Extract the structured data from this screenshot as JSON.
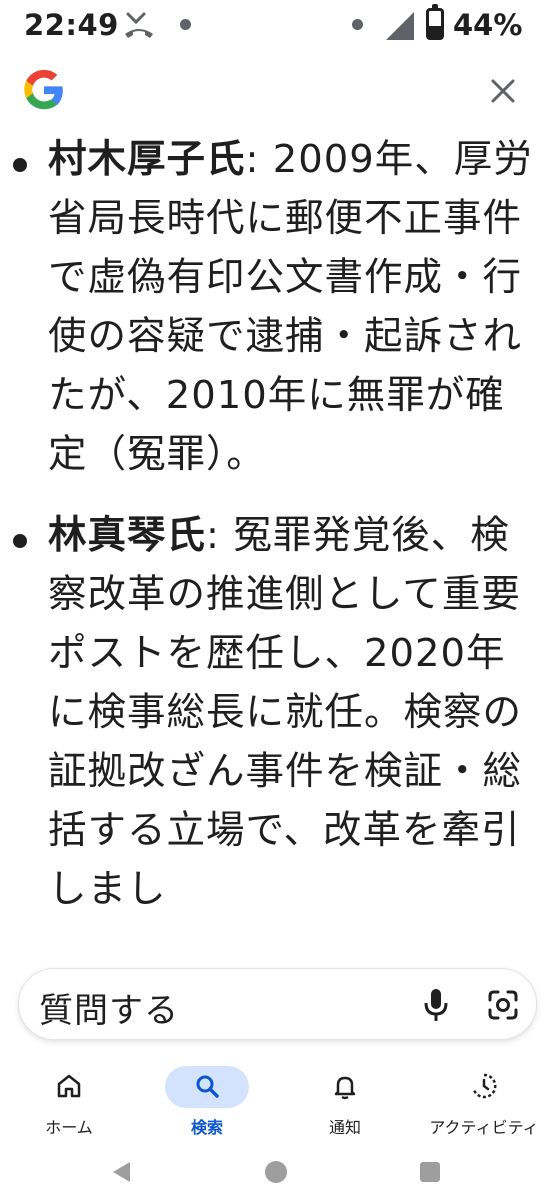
{
  "status_bar": {
    "time": "22:49",
    "battery_percent_text": "44%",
    "battery_level": 0.44
  },
  "header": {
    "logo_icon": "google-g-logo",
    "close_icon": "close-icon"
  },
  "content": {
    "items": [
      {
        "name": "村木厚子氏",
        "text": ": 2009年、厚労省局長時代に郵便不正事件で虚偽有印公文書作成・行使の容疑で逮捕・起訴されたが、2010年に無罪が確定（冤罪）。"
      },
      {
        "name": "林真琴氏",
        "text": ": 冤罪発覚後、検察改革の推進側として重要ポストを歴任し、2020年に検事総長に就任。検察の証拠改ざん事件を検証・総括する立場で、改革を牽引しまし"
      }
    ]
  },
  "ask_bar": {
    "placeholder": "質問する",
    "mic_icon": "mic-icon",
    "lens_icon": "lens-camera-icon"
  },
  "bottom_nav": {
    "items": [
      {
        "label": "ホーム",
        "icon": "home-icon",
        "active": false
      },
      {
        "label": "検索",
        "icon": "search-icon",
        "active": true
      },
      {
        "label": "通知",
        "icon": "bell-icon",
        "active": false
      },
      {
        "label": "アクティビティ",
        "icon": "activity-icon",
        "active": false
      }
    ]
  },
  "system_nav": {
    "back_icon": "back-triangle-icon",
    "home_icon": "home-circle-icon",
    "recents_icon": "recents-square-icon"
  },
  "colors": {
    "accent": "#0b57d0",
    "accent_pill": "#d3e3fd",
    "text": "#1f1f1f"
  }
}
